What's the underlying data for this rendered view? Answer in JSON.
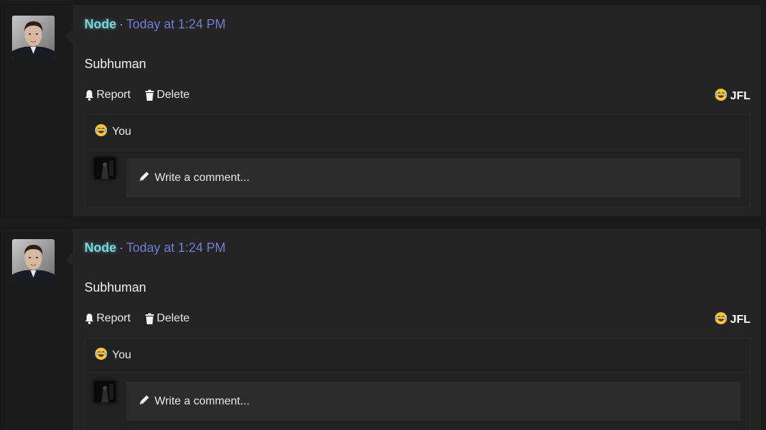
{
  "posts": [
    {
      "author": "Node",
      "separator": "·",
      "timestamp": "Today at 1:24 PM",
      "message": "Subhuman",
      "actions": {
        "report": "Report",
        "delete": "Delete"
      },
      "reaction_summary": {
        "icon": "laugh-cry-emoji",
        "label": "JFL"
      },
      "reactors": {
        "icon": "laugh-cry-emoji",
        "label": "You"
      },
      "comment_placeholder": "Write a comment..."
    },
    {
      "author": "Node",
      "separator": "·",
      "timestamp": "Today at 1:24 PM",
      "message": "Subhuman",
      "actions": {
        "report": "Report",
        "delete": "Delete"
      },
      "reaction_summary": {
        "icon": "laugh-cry-emoji",
        "label": "JFL"
      },
      "reactors": {
        "icon": "laugh-cry-emoji",
        "label": "You"
      },
      "comment_placeholder": "Write a comment..."
    }
  ],
  "colors": {
    "author": "#7fd6d6",
    "timestamp": "#6f7fd1",
    "background": "#1a1a1a",
    "panel": "#242424"
  }
}
